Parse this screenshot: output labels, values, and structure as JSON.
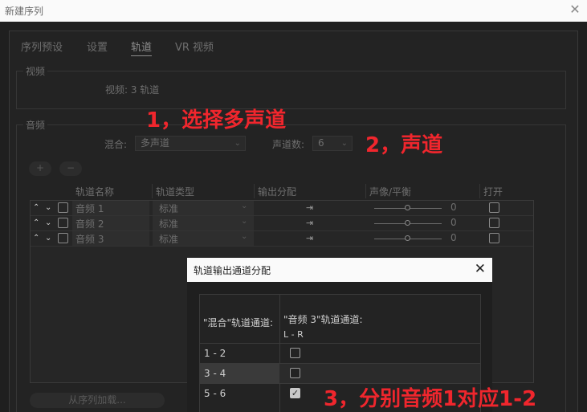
{
  "window": {
    "title": "新建序列",
    "close_glyph": "✕"
  },
  "tabs": [
    {
      "label": "序列预设",
      "active": false
    },
    {
      "label": "设置",
      "active": false
    },
    {
      "label": "轨道",
      "active": true
    },
    {
      "label": "VR 视频",
      "active": false
    }
  ],
  "video": {
    "group_label": "视频",
    "tracks_text": "视频: 3 轨道"
  },
  "audio": {
    "group_label": "音频",
    "mix_label": "混合:",
    "mix_value": "多声道",
    "channels_label": "声道数:",
    "channels_value": "6",
    "add_btn": "+",
    "remove_btn": "−",
    "columns": [
      "轨道名称",
      "轨道类型",
      "输出分配",
      "声像/平衡",
      "打开"
    ],
    "tracks": [
      {
        "name": "音频 1",
        "type": "标准",
        "pan": "0"
      },
      {
        "name": "音频 2",
        "type": "标准",
        "pan": "0"
      },
      {
        "name": "音频 3",
        "type": "标准",
        "pan": "0"
      }
    ],
    "load_btn": "从序列加载..."
  },
  "dialog": {
    "title": "轨道输出通道分配",
    "close_glyph": "✕",
    "left_header": "\"混合\"轨道通道:",
    "right_header": "\"音频 3\"轨道通道:",
    "right_sub": "L - R",
    "rows": [
      {
        "label": "1 - 2",
        "checked": false
      },
      {
        "label": "3 - 4",
        "checked": false
      },
      {
        "label": "5 - 6",
        "checked": true
      }
    ]
  },
  "annotations": {
    "step1": "1，选择多声道",
    "step2": "2，声道",
    "step3": "3，分别音频1对应1-2"
  },
  "colors": {
    "annotation_red": "#f0262d"
  }
}
